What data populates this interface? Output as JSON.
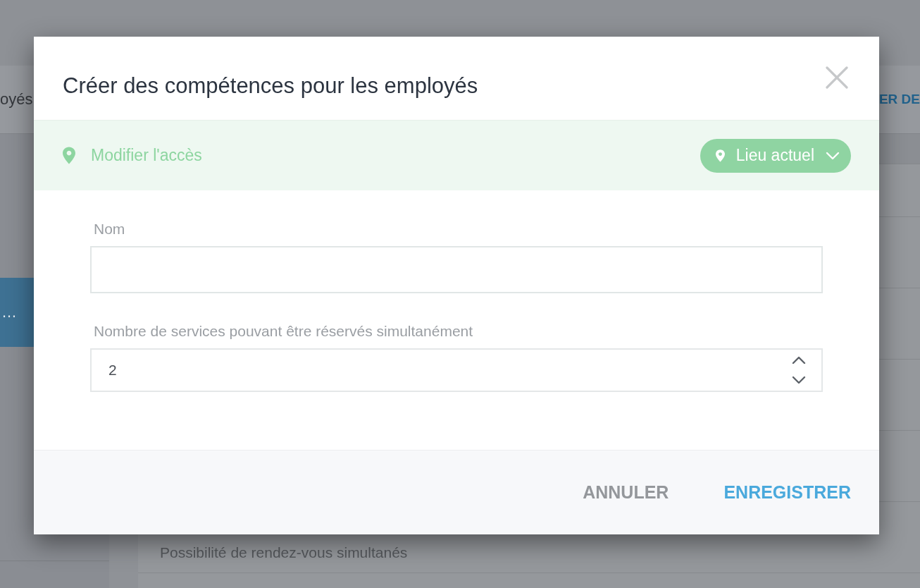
{
  "background": {
    "tab_bar": {
      "left_text": "oyés",
      "right_action": "ER DE"
    },
    "sidebar": {
      "items": [
        {
          "label": "…",
          "selected": true
        }
      ]
    },
    "list": {
      "rows": [
        {
          "text": "Possibilité de rendez-vous simultanés"
        }
      ]
    }
  },
  "dialog": {
    "title": "Créer des compétences pour les employés",
    "access_bar": {
      "label": "Modifier l'accès",
      "location_button": "Lieu actuel"
    },
    "fields": [
      {
        "kind": "text",
        "label": "Nom"
      },
      {
        "kind": "number",
        "label": "Nombre de services pouvant être réservés simultanément",
        "value": "2"
      }
    ],
    "buttons": [
      {
        "kind": "secondary",
        "label": "ANNULER"
      },
      {
        "kind": "primary",
        "label": "ENREGISTRER"
      }
    ]
  }
}
